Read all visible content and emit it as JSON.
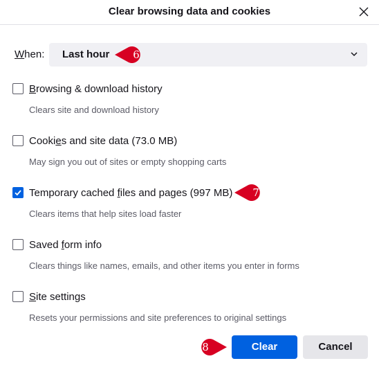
{
  "dialog": {
    "title": "Clear browsing data and cookies",
    "close_icon": "close-icon"
  },
  "when": {
    "label_underlined": "W",
    "label_rest": "hen:",
    "selected": "Last hour",
    "chevron_icon": "chevron-down-icon"
  },
  "options": [
    {
      "label_pre": "",
      "label_u": "B",
      "label_post": "rowsing & download history",
      "description": "Clears site and download history",
      "checked": false
    },
    {
      "label_pre": "Cooki",
      "label_u": "e",
      "label_post": "s and site data (73.0 MB)",
      "description": "May sign you out of sites or empty shopping carts",
      "checked": false
    },
    {
      "label_pre": "Temporary cached ",
      "label_u": "f",
      "label_post": "iles and pages (997 MB)",
      "description": "Clears items that help sites load faster",
      "checked": true
    },
    {
      "label_pre": "Saved ",
      "label_u": "f",
      "label_post": "orm info",
      "description": "Clears things like names, emails, and other items you enter in forms",
      "checked": false
    },
    {
      "label_pre": "",
      "label_u": "S",
      "label_post": "ite settings",
      "description": "Resets your permissions and site preferences to original settings",
      "checked": false
    }
  ],
  "buttons": {
    "clear": "Clear",
    "cancel": "Cancel"
  },
  "annotations": [
    "6",
    "7",
    "8"
  ],
  "colors": {
    "accent": "#0061e0",
    "marker": "#d70022"
  }
}
